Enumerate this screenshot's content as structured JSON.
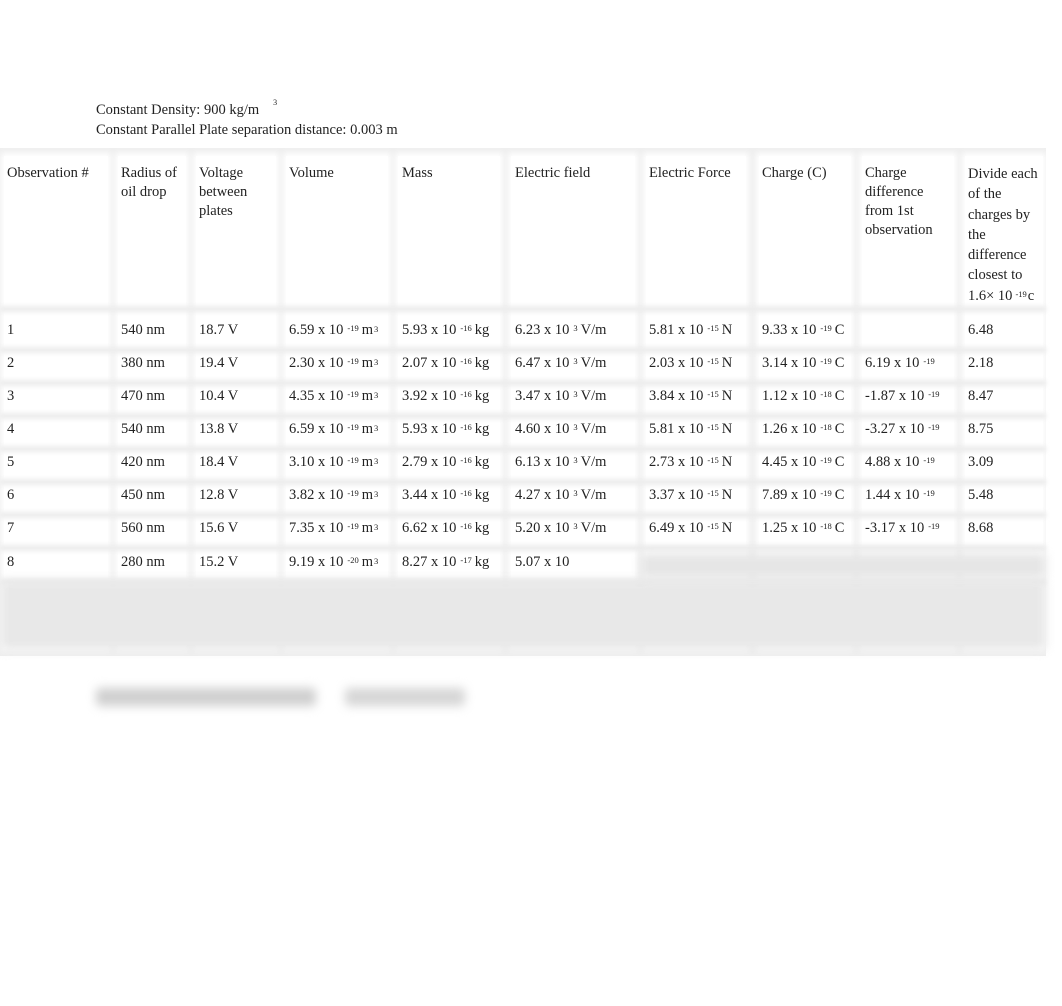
{
  "constants": {
    "density_label": "Constant Density: 900 kg/m",
    "density_exp": "3",
    "separation_label": "Constant Parallel Plate separation distance: 0.003 m"
  },
  "table": {
    "headers": [
      "Observation #",
      "Radius of oil drop",
      "Voltage between plates",
      "Volume",
      "Mass",
      "Electric field",
      "Electric Force",
      "Charge (C)",
      "Charge difference from 1st observation",
      "Divide each of the charges by the difference closest to 1.6× 10"
    ],
    "last_header_exp": "-19",
    "last_header_unit": "c",
    "rows": [
      {
        "obs": "1",
        "radius": "540 nm",
        "voltage": "18.7 V",
        "volume": "6.59 x 10",
        "volume_exp": "-19",
        "volume_unit": "m",
        "volume_unit_exp": "3",
        "mass": "5.93 x 10",
        "mass_exp": "-16",
        "mass_unit": "kg",
        "field": "6.23 x 10",
        "field_exp": "3",
        "field_unit": "V/m",
        "force": "5.81 x 10",
        "force_exp": "-15",
        "force_unit": "N",
        "charge": "9.33 x 10",
        "charge_exp": "-19",
        "charge_unit": "C",
        "diff": "",
        "diff_exp": "",
        "ratio": "6.48"
      },
      {
        "obs": "2",
        "radius": "380 nm",
        "voltage": "19.4 V",
        "volume": "2.30 x 10",
        "volume_exp": "-19",
        "volume_unit": "m",
        "volume_unit_exp": "3",
        "mass": "2.07 x 10",
        "mass_exp": "-16",
        "mass_unit": "kg",
        "field": "6.47 x 10",
        "field_exp": "3",
        "field_unit": "V/m",
        "force": "2.03 x 10",
        "force_exp": "-15",
        "force_unit": "N",
        "charge": "3.14 x 10",
        "charge_exp": "-19",
        "charge_unit": "C",
        "diff": "6.19 x 10",
        "diff_exp": "-19",
        "ratio": "2.18"
      },
      {
        "obs": "3",
        "radius": "470 nm",
        "voltage": "10.4 V",
        "volume": "4.35 x 10",
        "volume_exp": "-19",
        "volume_unit": "m",
        "volume_unit_exp": "3",
        "mass": "3.92 x 10",
        "mass_exp": "-16",
        "mass_unit": "kg",
        "field": "3.47 x 10",
        "field_exp": "3",
        "field_unit": "V/m",
        "force": "3.84 x 10",
        "force_exp": "-15",
        "force_unit": "N",
        "charge": "1.12 x 10",
        "charge_exp": "-18",
        "charge_unit": "C",
        "diff": "-1.87 x 10",
        "diff_exp": "-19",
        "ratio": "8.47"
      },
      {
        "obs": "4",
        "radius": "540 nm",
        "voltage": "13.8 V",
        "volume": "6.59 x 10",
        "volume_exp": "-19",
        "volume_unit": "m",
        "volume_unit_exp": "3",
        "mass": "5.93 x 10",
        "mass_exp": "-16",
        "mass_unit": "kg",
        "field": "4.60 x 10",
        "field_exp": "3",
        "field_unit": "V/m",
        "force": "5.81 x 10",
        "force_exp": "-15",
        "force_unit": "N",
        "charge": "1.26 x 10",
        "charge_exp": "-18",
        "charge_unit": "C",
        "diff": "-3.27 x 10",
        "diff_exp": "-19",
        "ratio": "8.75"
      },
      {
        "obs": "5",
        "radius": "420 nm",
        "voltage": "18.4 V",
        "volume": "3.10 x 10",
        "volume_exp": "-19",
        "volume_unit": "m",
        "volume_unit_exp": "3",
        "mass": "2.79 x 10",
        "mass_exp": "-16",
        "mass_unit": "kg",
        "field": "6.13 x 10",
        "field_exp": "3",
        "field_unit": "V/m",
        "force": "2.73 x 10",
        "force_exp": "-15",
        "force_unit": "N",
        "charge": "4.45 x 10",
        "charge_exp": "-19",
        "charge_unit": "C",
        "diff": "4.88 x 10",
        "diff_exp": "-19",
        "ratio": "3.09"
      },
      {
        "obs": "6",
        "radius": "450 nm",
        "voltage": "12.8 V",
        "volume": "3.82 x 10",
        "volume_exp": "-19",
        "volume_unit": "m",
        "volume_unit_exp": "3",
        "mass": "3.44 x 10",
        "mass_exp": "-16",
        "mass_unit": "kg",
        "field": "4.27 x 10",
        "field_exp": "3",
        "field_unit": "V/m",
        "force": "3.37 x 10",
        "force_exp": "-15",
        "force_unit": "N",
        "charge": "7.89 x 10",
        "charge_exp": "-19",
        "charge_unit": "C",
        "diff": "1.44 x 10",
        "diff_exp": "-19",
        "ratio": "5.48"
      },
      {
        "obs": "7",
        "radius": "560 nm",
        "voltage": "15.6 V",
        "volume": "7.35 x 10",
        "volume_exp": "-19",
        "volume_unit": "m",
        "volume_unit_exp": "3",
        "mass": "6.62 x 10",
        "mass_exp": "-16",
        "mass_unit": "kg",
        "field": "5.20 x 10",
        "field_exp": "3",
        "field_unit": "V/m",
        "force": "6.49 x 10",
        "force_exp": "-15",
        "force_unit": "N",
        "charge": "1.25 x 10",
        "charge_exp": "-18",
        "charge_unit": "C",
        "diff": "-3.17 x 10",
        "diff_exp": "-19",
        "ratio": "8.68"
      },
      {
        "obs": "8",
        "radius": "280 nm",
        "voltage": "15.2 V",
        "volume": "9.19 x 10",
        "volume_exp": "-20",
        "volume_unit": "m",
        "volume_unit_exp": "3",
        "mass": "8.27 x 10",
        "mass_exp": "-17",
        "mass_unit": "kg",
        "field": "5.07 x 10",
        "field_exp": "",
        "field_unit": "",
        "force": "",
        "force_exp": "",
        "force_unit": "",
        "charge": "",
        "charge_exp": "",
        "charge_unit": "",
        "diff": "",
        "diff_exp": "",
        "ratio": ""
      }
    ]
  }
}
